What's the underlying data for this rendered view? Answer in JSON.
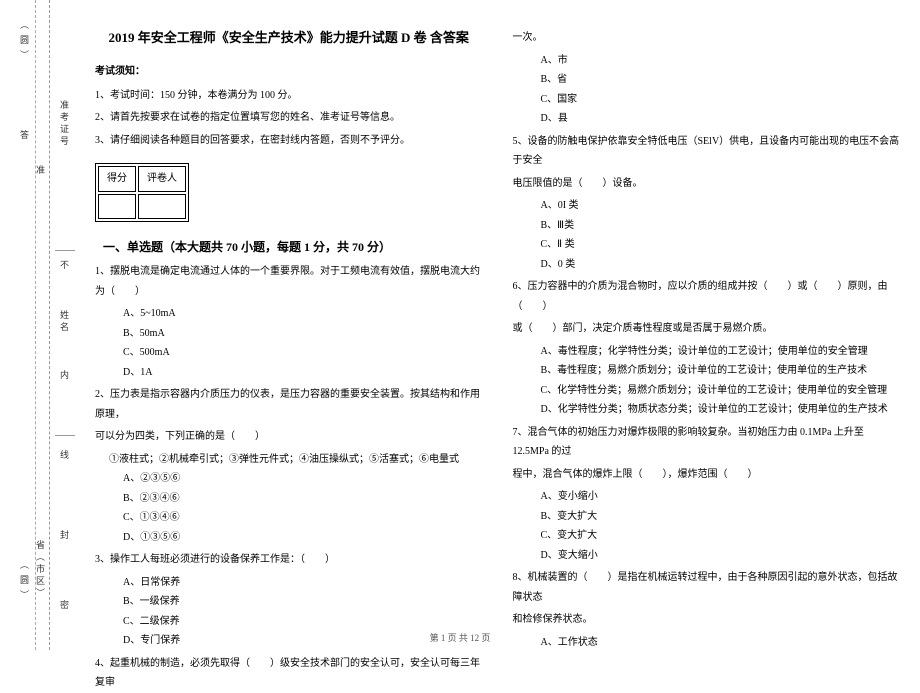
{
  "binding": {
    "circle1": "（圆）",
    "circle2": "（圆）",
    "label_exam_no": "准考证号",
    "label_name": "姓名",
    "label_province": "省（市区）",
    "seal_outer": "密",
    "seal_mid": "封",
    "seal_inner": "线",
    "inner": "内",
    "not": "不",
    "answer": "答",
    "prefix": "准"
  },
  "header": {
    "title": "2019 年安全工程师《安全生产技术》能力提升试题 D 卷  含答案"
  },
  "notice": {
    "heading": "考试须知：",
    "n1": "1、考试时间：150 分钟，本卷满分为 100 分。",
    "n2": "2、请首先按要求在试卷的指定位置填写您的姓名、准考证号等信息。",
    "n3": "3、请仔细阅读各种题目的回答要求，在密封线内答题，否则不予评分。"
  },
  "scorebox": {
    "c1": "得分",
    "c2": "评卷人"
  },
  "part1": {
    "title": "一、单选题（本大题共 70 小题，每题 1 分，共 70 分）"
  },
  "q1": {
    "stem": "1、摆脱电流是确定电流通过人体的一个重要界限。对于工频电流有效值，摆脱电流大约为（　　）",
    "a": "A、5~10mA",
    "b": "B、50mA",
    "c": "C、500mA",
    "d": "D、1A"
  },
  "q2": {
    "stem": "2、压力表是指示容器内介质压力的仪表，是压力容器的重要安全装置。按其结构和作用原理，",
    "stem2": "可以分为四类，下列正确的是（　　）",
    "line": "①液柱式；②机械牵引式；③弹性元件式；④油压操纵式；⑤活塞式；⑥电量式",
    "a": "A、②③⑤⑥",
    "b": "B、②③④⑥",
    "c": "C、①③④⑥",
    "d": "D、①③⑤⑥"
  },
  "q3": {
    "stem": "3、操作工人每班必须进行的设备保养工作是：（　　）",
    "a": "A、日常保养",
    "b": "B、一级保养",
    "c": "C、二级保养",
    "d": "D、专门保养"
  },
  "q4": {
    "stem": "4、起重机械的制造，必须先取得（　　）级安全技术部门的安全认可，安全认可每三年复审"
  },
  "q4r": {
    "cont": "一次。",
    "a": "A、市",
    "b": "B、省",
    "c": "C、国家",
    "d": "D、县"
  },
  "q5": {
    "stem": "5、设备的防触电保护依靠安全特低电压（SElV）供电，且设备内可能出现的电压不会高于安全",
    "stem2": "电压限值的是（　　）设备。",
    "a": "A、0I 类",
    "b": "B、Ⅲ类",
    "c": "C、Ⅱ 类",
    "d": "D、0 类"
  },
  "q6": {
    "stem": "6、压力容器中的介质为混合物时，应以介质的组成并按（　　）或（　　）原则，由（　　）",
    "stem2": "或（　　）部门，决定介质毒性程度或是否属于易燃介质。",
    "a": "A、毒性程度；化学特性分类；设计单位的工艺设计；使用单位的安全管理",
    "b": "B、毒性程度；易燃介质划分；设计单位的工艺设计；使用单位的生产技术",
    "c": "C、化学特性分类；易燃介质划分；设计单位的工艺设计；使用单位的安全管理",
    "d": "D、化学特性分类；物质状态分类；设计单位的工艺设计；使用单位的生产技术"
  },
  "q7": {
    "stem": "7、混合气体的初始压力对爆炸极限的影响较复杂。当初始压力由 0.1MPa 上升至 12.5MPa 的过",
    "stem2": "程中，混合气体的爆炸上限（　　），爆炸范围（　　）",
    "a": "A、变小缩小",
    "b": "B、变大扩大",
    "c": "C、变大扩大",
    "d": "D、变大缩小"
  },
  "q8": {
    "stem": "8、机械装置的（　　）是指在机械运转过程中，由于各种原因引起的意外状态，包括故障状态",
    "stem2": "和检修保养状态。",
    "a": "A、工作状态"
  },
  "footer": "第 1 页 共 12 页"
}
